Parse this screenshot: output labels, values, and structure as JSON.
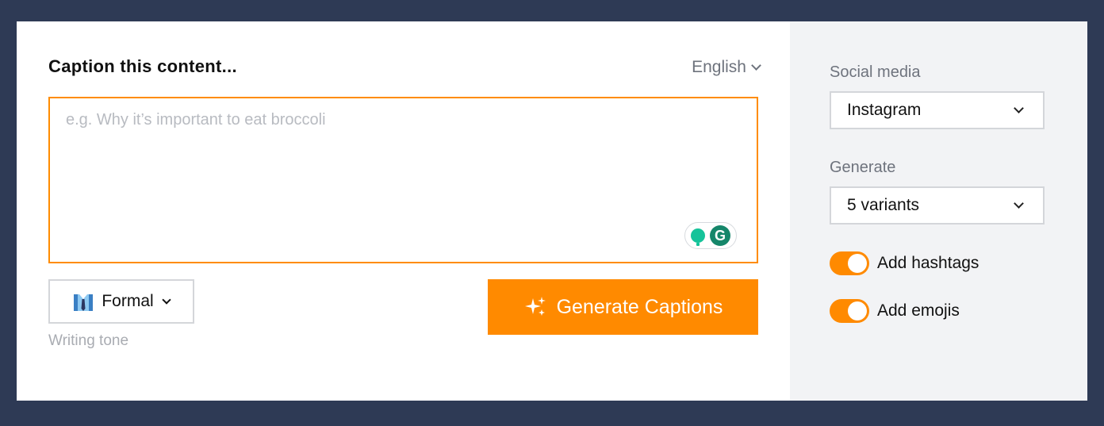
{
  "main": {
    "title": "Caption this content...",
    "language": "English",
    "input_placeholder": "e.g. Why it’s important to eat broccoli",
    "input_value": "",
    "tone_value": "Formal",
    "tone_caption": "Writing tone",
    "generate_label": "Generate Captions",
    "grammarly_letter": "G"
  },
  "sidebar": {
    "social_label": "Social media",
    "social_value": "Instagram",
    "generate_label": "Generate",
    "generate_value": "5 variants",
    "hashtags_label": "Add hashtags",
    "hashtags_on": true,
    "emojis_label": "Add emojis",
    "emojis_on": true
  },
  "colors": {
    "accent": "#ff8a00",
    "page_background": "#2e3a55",
    "sidebar_background": "#f2f3f5",
    "grammarly_green": "#15c39a"
  },
  "icons": {
    "language_dropdown": "chevron-down-icon",
    "tone": "formal-shirt-icon",
    "generate": "sparkles-icon",
    "grammarly": "grammarly-icon"
  }
}
